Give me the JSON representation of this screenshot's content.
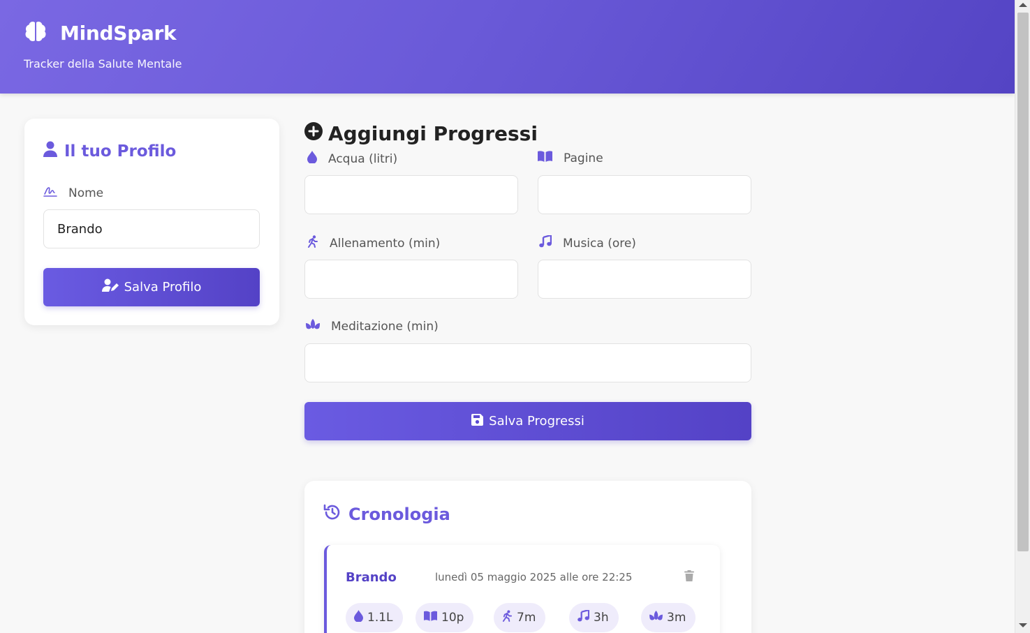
{
  "app": {
    "name": "MindSpark",
    "subtitle": "Tracker della Salute Mentale"
  },
  "colors": {
    "accent": "#6b5add",
    "accent_dark": "#5442c6",
    "chip_bg": "#efecfb"
  },
  "profile": {
    "title": "Il tuo Profilo",
    "name_label": "Nome",
    "name_value": "Brando",
    "save_label": "Salva Profilo"
  },
  "progress": {
    "title": "Aggiungi Progressi",
    "fields": {
      "water": {
        "label": "Acqua (litri)",
        "value": ""
      },
      "pages": {
        "label": "Pagine",
        "value": ""
      },
      "workout": {
        "label": "Allenamento (min)",
        "value": ""
      },
      "music": {
        "label": "Musica (ore)",
        "value": ""
      },
      "meditation": {
        "label": "Meditazione (min)",
        "value": ""
      }
    },
    "save_label": "Salva Progressi"
  },
  "history": {
    "title": "Cronologia",
    "entries": [
      {
        "name": "Brando",
        "date": "lunedì 05 maggio 2025 alle ore 22:25",
        "stats": {
          "water": "1.1L",
          "pages": "10p",
          "workout": "7m",
          "music": "3h",
          "meditation": "3m"
        }
      }
    ]
  },
  "icons": [
    "brain-icon",
    "user-icon",
    "signature-icon",
    "user-edit-icon",
    "plus-circle-icon",
    "droplet-icon",
    "book-open-icon",
    "running-icon",
    "music-icon",
    "lotus-icon",
    "save-icon",
    "history-icon",
    "trash-icon"
  ]
}
